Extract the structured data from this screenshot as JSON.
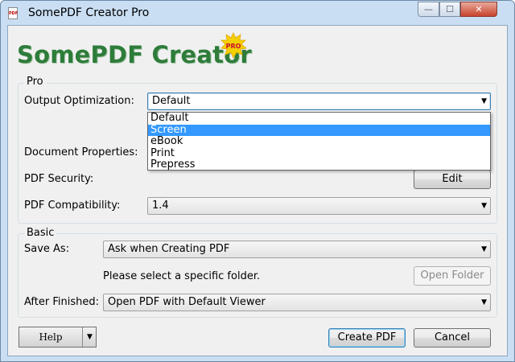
{
  "window": {
    "title": "SomePDF Creator Pro",
    "icon_text": "PDF",
    "icon_name": "pdf-app-icon",
    "controls": {
      "minimize_glyph": "—",
      "maximize_glyph": "☐",
      "close_glyph": "✕"
    }
  },
  "logo": {
    "text": "SomePDF Creator",
    "badge": "PRO"
  },
  "pro_group": {
    "title": "Pro",
    "output_optimization": {
      "label": "Output Optimization:",
      "value": "Default",
      "options": [
        "Default",
        "Screen",
        "eBook",
        "Print",
        "Prepress"
      ],
      "highlighted": "Screen"
    },
    "document_properties": {
      "label": "Document Properties:"
    },
    "pdf_security": {
      "label": "PDF Security:",
      "button": "Edit"
    },
    "pdf_compatibility": {
      "label": "PDF Compatibility:",
      "value": "1.4"
    }
  },
  "basic_group": {
    "title": "Basic",
    "save_as": {
      "label": "Save As:",
      "value": "Ask when Creating PDF"
    },
    "folder_hint": "Please select a specific folder.",
    "open_folder_button": "Open Folder",
    "after_finished": {
      "label": "After Finished:",
      "value": "Open PDF with Default Viewer"
    }
  },
  "footer": {
    "help_button": "Help",
    "help_arrow_glyph": "▼",
    "create_button": "Create PDF",
    "cancel_button": "Cancel"
  },
  "dropdown_arrow_glyph": "▼",
  "colors": {
    "logo_green": "#2e7c3a",
    "selection_blue": "#3399ff",
    "badge_yellow": "#f5d000",
    "badge_red": "#c8102e"
  }
}
